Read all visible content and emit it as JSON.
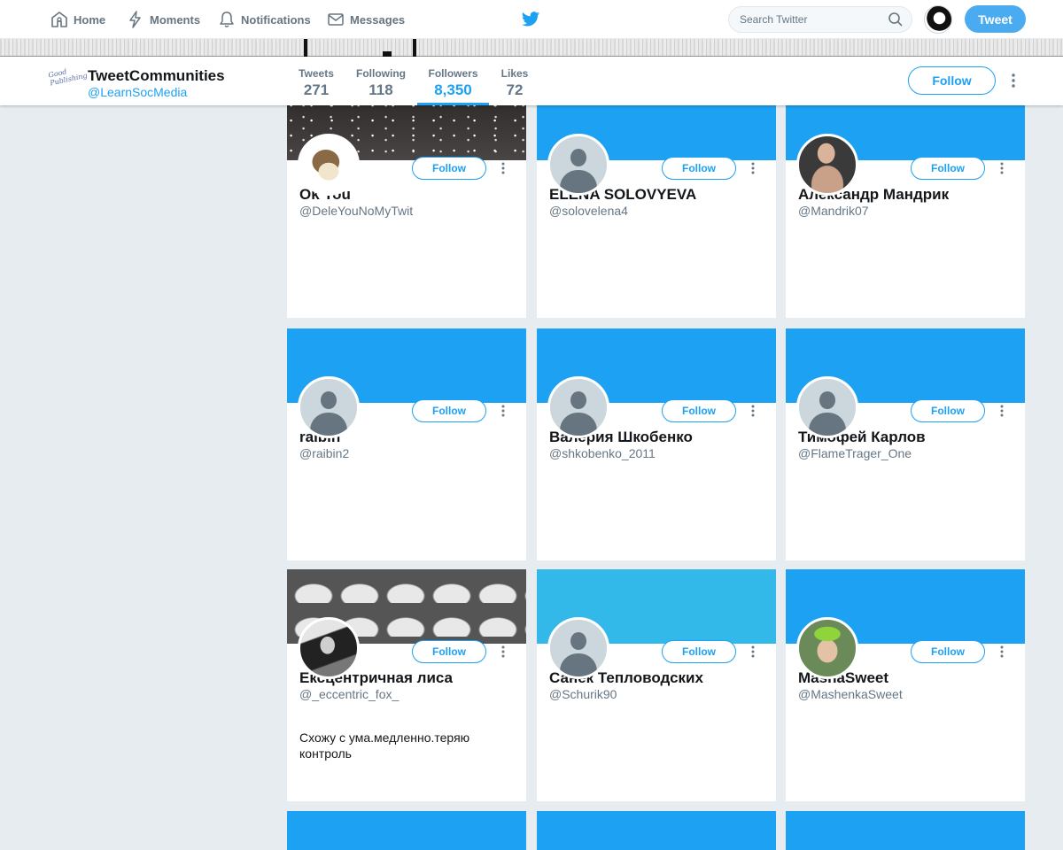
{
  "nav": {
    "home": "Home",
    "moments": "Moments",
    "notifications": "Notifications",
    "messages": "Messages",
    "search_placeholder": "Search Twitter",
    "tweet_button": "Tweet"
  },
  "profile": {
    "logo_text": "Good Publishing",
    "name": "TweetCommunities",
    "handle": "@LearnSocMedia",
    "follow_label": "Follow",
    "stats": [
      {
        "label": "Tweets",
        "value": "271"
      },
      {
        "label": "Following",
        "value": "118"
      },
      {
        "label": "Followers",
        "value": "8,350"
      },
      {
        "label": "Likes",
        "value": "72"
      }
    ],
    "active_stat": "Followers"
  },
  "cards": [
    {
      "name": "Ok You",
      "handle": "@DeleYouNoMyTwit",
      "bio": "",
      "banner": "stars",
      "avatar": "eevee",
      "follow": "Follow"
    },
    {
      "name": "ELENA SOLOVYEVA",
      "handle": "@solovelena4",
      "bio": "",
      "banner": "blue",
      "avatar": "default",
      "follow": "Follow"
    },
    {
      "name": "Александр Мандрик",
      "handle": "@Mandrik07",
      "bio": "",
      "banner": "blue",
      "avatar": "photo-man",
      "follow": "Follow"
    },
    {
      "name": "raibin",
      "handle": "@raibin2",
      "bio": "",
      "banner": "blue",
      "avatar": "default",
      "follow": "Follow"
    },
    {
      "name": "Валерия Шкобенко",
      "handle": "@shkobenko_2011",
      "bio": "",
      "banner": "blue",
      "avatar": "default",
      "follow": "Follow"
    },
    {
      "name": "Тимофей Карлов",
      "handle": "@FlameTrager_One",
      "bio": "",
      "banner": "blue",
      "avatar": "default",
      "follow": "Follow"
    },
    {
      "name": "Ексцентричная лиса",
      "handle": "@_eccentric_fox_",
      "bio": "Схожу с ума.медленно.теряю контроль",
      "banner": "pills",
      "avatar": "photo-bw",
      "follow": "Follow"
    },
    {
      "name": "Санёк Тепловодских",
      "handle": "@Schurik90",
      "bio": "",
      "banner": "lightblue",
      "avatar": "default",
      "follow": "Follow"
    },
    {
      "name": "MashaSweet",
      "handle": "@MashenkaSweet",
      "bio": "",
      "banner": "blue",
      "avatar": "photo-child",
      "follow": "Follow"
    }
  ],
  "colors": {
    "accent": "#1da1f2",
    "background": "#e6ecf0",
    "tweet_button": "#4aabf0"
  }
}
